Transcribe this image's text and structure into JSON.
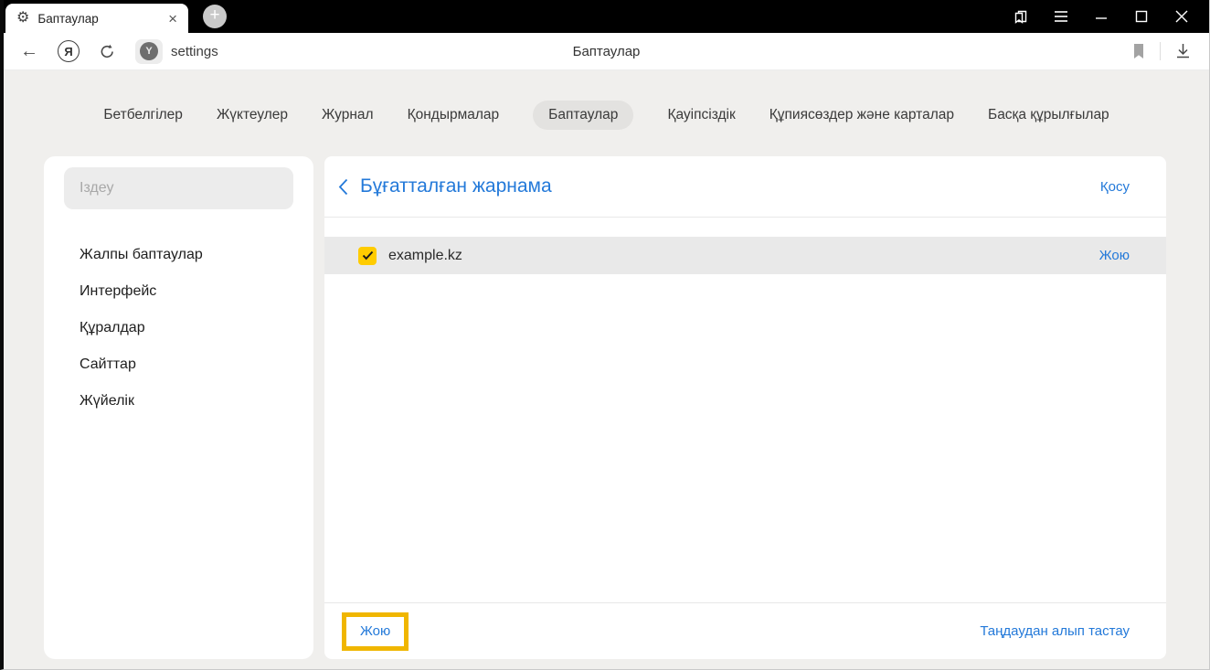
{
  "window": {
    "tab": {
      "title": "Баптаулар"
    }
  },
  "icons": {
    "tab_gear": "⚙",
    "tab_close": "×",
    "new_tab_plus": "+",
    "back_arrow": "←",
    "yandex_logo_letter": "Я",
    "protect_letter": "Y"
  },
  "toolbar": {
    "url_text": "settings",
    "page_title": "Баптаулар"
  },
  "nav": {
    "items": [
      {
        "label": "Бетбелгілер",
        "active": false
      },
      {
        "label": "Жүктеулер",
        "active": false
      },
      {
        "label": "Журнал",
        "active": false
      },
      {
        "label": "Қондырмалар",
        "active": false
      },
      {
        "label": "Баптаулар",
        "active": true
      },
      {
        "label": "Қауіпсіздік",
        "active": false
      },
      {
        "label": "Құпиясөздер және карталар",
        "active": false
      },
      {
        "label": "Басқа құрылғылар",
        "active": false
      }
    ]
  },
  "sidebar": {
    "search_placeholder": "Іздеу",
    "items": [
      "Жалпы баптаулар",
      "Интерфейс",
      "Құралдар",
      "Сайттар",
      "Жүйелік"
    ]
  },
  "main": {
    "title": "Бұғатталған жарнама",
    "add_label": "Қосу",
    "rows": [
      {
        "site": "example.kz",
        "checked": true,
        "delete_label": "Жою"
      }
    ],
    "footer": {
      "delete_label": "Жою",
      "deselect_label": "Таңдаудан алып тастау"
    }
  },
  "colors": {
    "accent_blue": "#2379d9",
    "highlight_gold": "#f0b600",
    "checkbox_yellow": "#ffcc00",
    "row_gray": "#e9e9e9",
    "page_bg": "#f0efed",
    "titlebar_black": "#000000"
  }
}
